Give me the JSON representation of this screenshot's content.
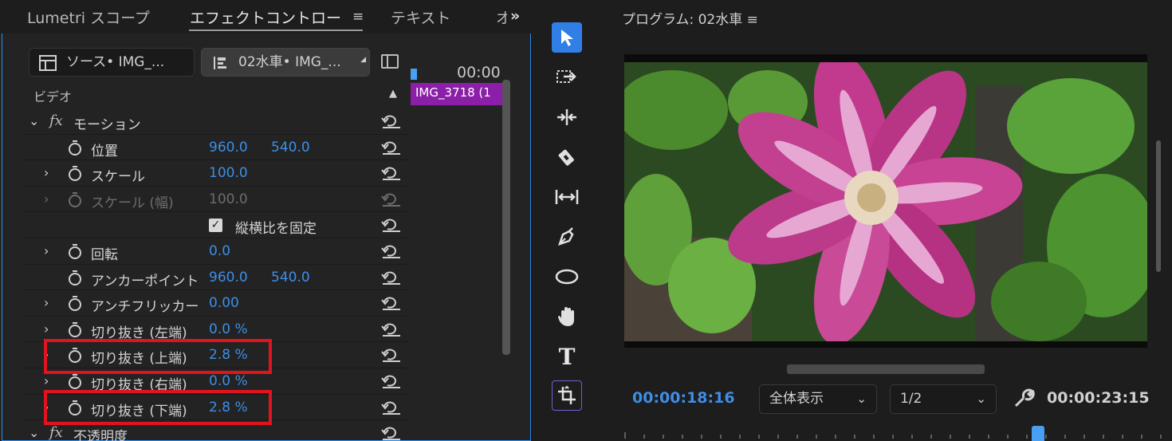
{
  "tabs": [
    {
      "label": "Lumetri スコープ",
      "active": false
    },
    {
      "label": "エフェクトコントロー",
      "active": true
    },
    {
      "label": "テキスト",
      "active": false
    },
    {
      "label": "オ",
      "active": false
    }
  ],
  "source_bar": {
    "source_label": "ソース• IMG_...",
    "sequence_label": "02水車• IMG_..."
  },
  "section_label": "ビデオ",
  "effects": [
    {
      "type": "group",
      "label": "モーション",
      "expanded": true
    },
    {
      "type": "prop",
      "label": "位置",
      "values": [
        "960.0",
        "540.0"
      ],
      "expandable": false
    },
    {
      "type": "prop",
      "label": "スケール",
      "values": [
        "100.0"
      ],
      "expandable": true
    },
    {
      "type": "prop",
      "label": "スケール (幅)",
      "values": [
        "100.0"
      ],
      "expandable": true,
      "disabled": true
    },
    {
      "type": "checkbox",
      "label": "縦横比を固定",
      "checked": true
    },
    {
      "type": "prop",
      "label": "回転",
      "values": [
        "0.0"
      ],
      "expandable": true
    },
    {
      "type": "prop",
      "label": "アンカーポイント",
      "values": [
        "960.0",
        "540.0"
      ],
      "expandable": false
    },
    {
      "type": "prop",
      "label": "アンチフリッカー",
      "values": [
        "0.00"
      ],
      "expandable": true
    },
    {
      "type": "prop",
      "label": "切り抜き (左端)",
      "values": [
        "0.0 %"
      ],
      "expandable": true
    },
    {
      "type": "prop",
      "label": "切り抜き (上端)",
      "values": [
        "2.8 %"
      ],
      "expandable": true,
      "highlighted": true
    },
    {
      "type": "prop",
      "label": "切り抜き (右端)",
      "values": [
        "0.0 %"
      ],
      "expandable": true
    },
    {
      "type": "prop",
      "label": "切り抜き (下端)",
      "values": [
        "2.8 %"
      ],
      "expandable": true,
      "highlighted": true
    },
    {
      "type": "group",
      "label": "不透明度",
      "expanded": true
    }
  ],
  "mini_timeline": {
    "timecode": "00:00",
    "clip_label": "IMG_3718 (1"
  },
  "tools": [
    "selection-tool",
    "track-select-tool",
    "ripple-edit-tool",
    "razor-tool",
    "slip-tool",
    "pen-tool",
    "ellipse-tool",
    "hand-tool",
    "type-tool",
    "extra-tool"
  ],
  "program": {
    "title": "プログラム: 02水車",
    "current_timecode": "00:00:18:16",
    "duration_timecode": "00:00:23:15",
    "zoom_option": "全体表示",
    "resolution_option": "1/2"
  },
  "colors": {
    "accent": "#2d8ceb",
    "value_blue": "#3d8ee8",
    "highlight_red": "#e0141e",
    "clip_purple": "#8b1fa8"
  }
}
